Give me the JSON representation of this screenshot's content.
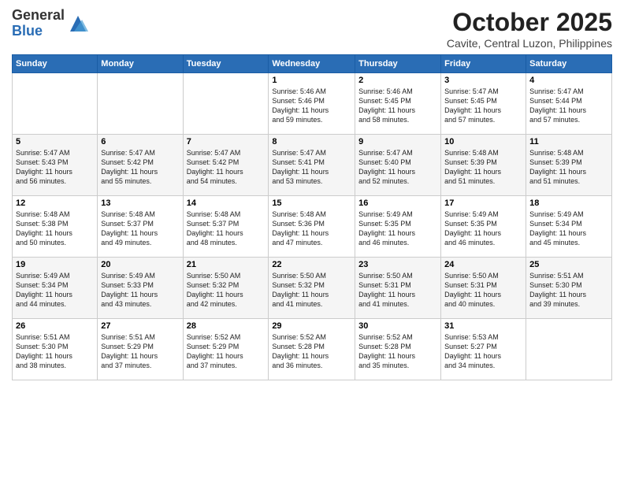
{
  "logo": {
    "general": "General",
    "blue": "Blue"
  },
  "title": "October 2025",
  "location": "Cavite, Central Luzon, Philippines",
  "days_of_week": [
    "Sunday",
    "Monday",
    "Tuesday",
    "Wednesday",
    "Thursday",
    "Friday",
    "Saturday"
  ],
  "weeks": [
    [
      {
        "day": "",
        "content": ""
      },
      {
        "day": "",
        "content": ""
      },
      {
        "day": "",
        "content": ""
      },
      {
        "day": "1",
        "content": "Sunrise: 5:46 AM\nSunset: 5:46 PM\nDaylight: 11 hours\nand 59 minutes."
      },
      {
        "day": "2",
        "content": "Sunrise: 5:46 AM\nSunset: 5:45 PM\nDaylight: 11 hours\nand 58 minutes."
      },
      {
        "day": "3",
        "content": "Sunrise: 5:47 AM\nSunset: 5:45 PM\nDaylight: 11 hours\nand 57 minutes."
      },
      {
        "day": "4",
        "content": "Sunrise: 5:47 AM\nSunset: 5:44 PM\nDaylight: 11 hours\nand 57 minutes."
      }
    ],
    [
      {
        "day": "5",
        "content": "Sunrise: 5:47 AM\nSunset: 5:43 PM\nDaylight: 11 hours\nand 56 minutes."
      },
      {
        "day": "6",
        "content": "Sunrise: 5:47 AM\nSunset: 5:42 PM\nDaylight: 11 hours\nand 55 minutes."
      },
      {
        "day": "7",
        "content": "Sunrise: 5:47 AM\nSunset: 5:42 PM\nDaylight: 11 hours\nand 54 minutes."
      },
      {
        "day": "8",
        "content": "Sunrise: 5:47 AM\nSunset: 5:41 PM\nDaylight: 11 hours\nand 53 minutes."
      },
      {
        "day": "9",
        "content": "Sunrise: 5:47 AM\nSunset: 5:40 PM\nDaylight: 11 hours\nand 52 minutes."
      },
      {
        "day": "10",
        "content": "Sunrise: 5:48 AM\nSunset: 5:39 PM\nDaylight: 11 hours\nand 51 minutes."
      },
      {
        "day": "11",
        "content": "Sunrise: 5:48 AM\nSunset: 5:39 PM\nDaylight: 11 hours\nand 51 minutes."
      }
    ],
    [
      {
        "day": "12",
        "content": "Sunrise: 5:48 AM\nSunset: 5:38 PM\nDaylight: 11 hours\nand 50 minutes."
      },
      {
        "day": "13",
        "content": "Sunrise: 5:48 AM\nSunset: 5:37 PM\nDaylight: 11 hours\nand 49 minutes."
      },
      {
        "day": "14",
        "content": "Sunrise: 5:48 AM\nSunset: 5:37 PM\nDaylight: 11 hours\nand 48 minutes."
      },
      {
        "day": "15",
        "content": "Sunrise: 5:48 AM\nSunset: 5:36 PM\nDaylight: 11 hours\nand 47 minutes."
      },
      {
        "day": "16",
        "content": "Sunrise: 5:49 AM\nSunset: 5:35 PM\nDaylight: 11 hours\nand 46 minutes."
      },
      {
        "day": "17",
        "content": "Sunrise: 5:49 AM\nSunset: 5:35 PM\nDaylight: 11 hours\nand 46 minutes."
      },
      {
        "day": "18",
        "content": "Sunrise: 5:49 AM\nSunset: 5:34 PM\nDaylight: 11 hours\nand 45 minutes."
      }
    ],
    [
      {
        "day": "19",
        "content": "Sunrise: 5:49 AM\nSunset: 5:34 PM\nDaylight: 11 hours\nand 44 minutes."
      },
      {
        "day": "20",
        "content": "Sunrise: 5:49 AM\nSunset: 5:33 PM\nDaylight: 11 hours\nand 43 minutes."
      },
      {
        "day": "21",
        "content": "Sunrise: 5:50 AM\nSunset: 5:32 PM\nDaylight: 11 hours\nand 42 minutes."
      },
      {
        "day": "22",
        "content": "Sunrise: 5:50 AM\nSunset: 5:32 PM\nDaylight: 11 hours\nand 41 minutes."
      },
      {
        "day": "23",
        "content": "Sunrise: 5:50 AM\nSunset: 5:31 PM\nDaylight: 11 hours\nand 41 minutes."
      },
      {
        "day": "24",
        "content": "Sunrise: 5:50 AM\nSunset: 5:31 PM\nDaylight: 11 hours\nand 40 minutes."
      },
      {
        "day": "25",
        "content": "Sunrise: 5:51 AM\nSunset: 5:30 PM\nDaylight: 11 hours\nand 39 minutes."
      }
    ],
    [
      {
        "day": "26",
        "content": "Sunrise: 5:51 AM\nSunset: 5:30 PM\nDaylight: 11 hours\nand 38 minutes."
      },
      {
        "day": "27",
        "content": "Sunrise: 5:51 AM\nSunset: 5:29 PM\nDaylight: 11 hours\nand 37 minutes."
      },
      {
        "day": "28",
        "content": "Sunrise: 5:52 AM\nSunset: 5:29 PM\nDaylight: 11 hours\nand 37 minutes."
      },
      {
        "day": "29",
        "content": "Sunrise: 5:52 AM\nSunset: 5:28 PM\nDaylight: 11 hours\nand 36 minutes."
      },
      {
        "day": "30",
        "content": "Sunrise: 5:52 AM\nSunset: 5:28 PM\nDaylight: 11 hours\nand 35 minutes."
      },
      {
        "day": "31",
        "content": "Sunrise: 5:53 AM\nSunset: 5:27 PM\nDaylight: 11 hours\nand 34 minutes."
      },
      {
        "day": "",
        "content": ""
      }
    ]
  ]
}
